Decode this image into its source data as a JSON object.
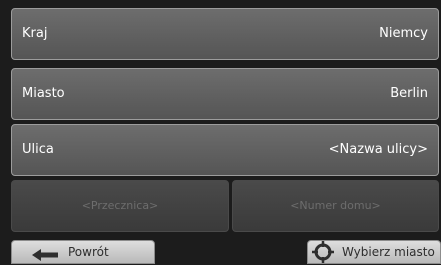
{
  "rows": {
    "country": {
      "label": "Kraj",
      "value": "Niemcy"
    },
    "city": {
      "label": "Miasto",
      "value": "Berlin"
    },
    "street": {
      "label": "Ulica",
      "value": "<Nazwa ulicy>"
    }
  },
  "secondary": {
    "crossroad_placeholder": "<Przecznica>",
    "house_number_placeholder": "<Numer domu>"
  },
  "footer": {
    "back_label": "Powrót",
    "back_icon": "arrow-left-icon",
    "select_city_label": "Wybierz miasto",
    "select_city_icon": "crosshair-icon"
  }
}
